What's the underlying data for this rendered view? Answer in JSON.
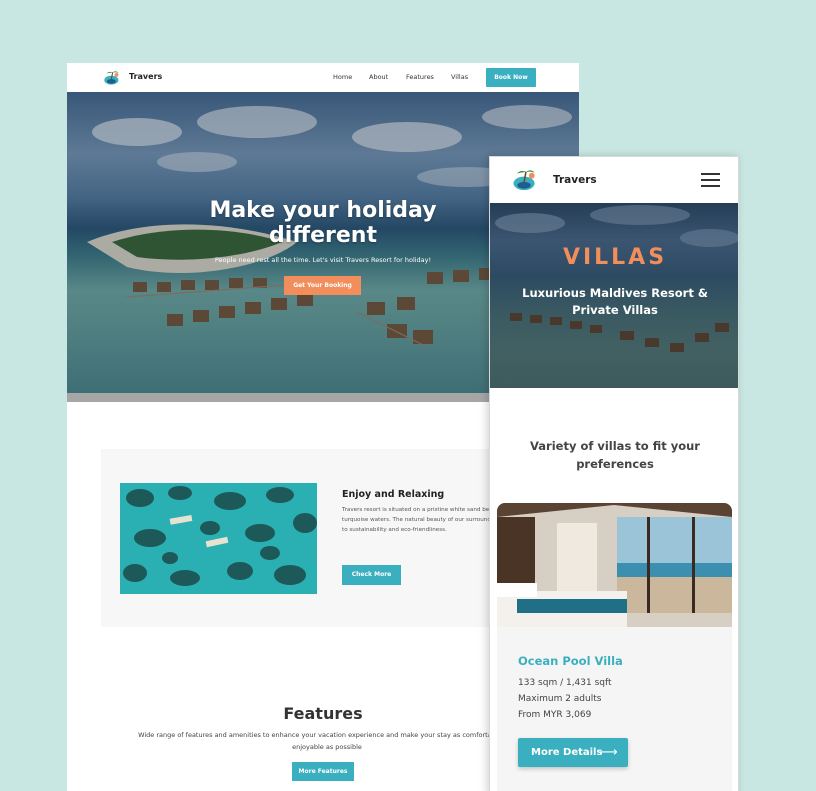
{
  "desktop": {
    "brand": "Travers",
    "nav": [
      "Home",
      "About",
      "Features",
      "Villas"
    ],
    "cta": "Book Now",
    "hero": {
      "title_line1": "Make your holiday",
      "title_line2": "different",
      "subtitle": "People need rest all the time. Let's visit Travers Resort for holiday!",
      "button": "Get Your Booking"
    },
    "enjoy": {
      "title": "Enjoy and Relaxing",
      "text": "Travers resort is situated on a pristine white sand beach surrounded by crystal clear turquoise waters. The natural beauty of our surroundings is enhanced by our commitment to sustainability and eco-friendliness.",
      "button": "Check More"
    },
    "features": {
      "title": "Features",
      "text": "Wide range of features and amenities to enhance your vacation experience and make your stay as comfortable and enjoyable as possible",
      "button": "More Features"
    }
  },
  "mobile": {
    "brand": "Travers",
    "hero": {
      "title": "VILLAS",
      "subtitle": "Luxurious Maldives Resort & Private Villas"
    },
    "section_title": "Variety of villas to fit your preferences",
    "villa": {
      "name": "Ocean Pool Villa",
      "size": "133 sqm / 1,431 sqft",
      "capacity": "Maximum 2 adults",
      "price": "From MYR 3,069",
      "button": "More Details",
      "button_icon": "arrow-right-icon"
    }
  },
  "colors": {
    "background": "#c9e7e2",
    "accent": "#3aafbf",
    "orange": "#f28e5b"
  }
}
